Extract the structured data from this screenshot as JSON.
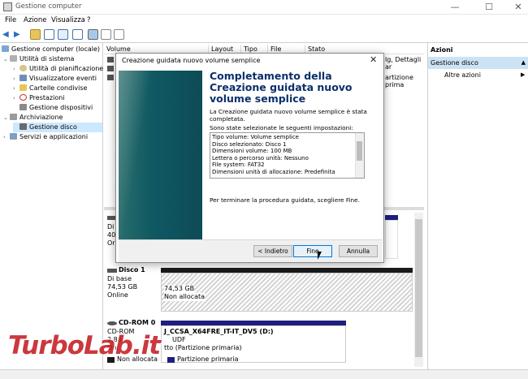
{
  "window": {
    "title": "Gestione computer",
    "minimize": "—",
    "maximize": "☐",
    "close": "✕"
  },
  "menu": [
    "File",
    "Azione",
    "Visualizza",
    "?"
  ],
  "tree": {
    "root": "Gestione computer (locale)",
    "items": [
      "Utilità di sistema",
      "Utilità di pianificazione",
      "Visualizzatore eventi",
      "Cartelle condivise",
      "Prestazioni",
      "Gestione dispositivi",
      "Archiviazione",
      "Gestione disco",
      "Servizi e applicazioni"
    ]
  },
  "volume_table": {
    "columns": [
      "Volume",
      "Layout",
      "Tipo",
      "File system",
      "Stato"
    ],
    "row_fragments": [
      "lg, Dettagli ar",
      "artizione prima"
    ]
  },
  "disks": {
    "disk0": {
      "lines": [
        "Di",
        "40",
        "Or"
      ]
    },
    "disk1": {
      "name": "Disco 1",
      "type": "Di base",
      "size": "74,53 GB",
      "status": "Online",
      "partition_size": "74,53 GB",
      "partition_state": "Non allocata"
    },
    "cdrom": {
      "name": "CD-ROM 0",
      "type": "CD-ROM",
      "size": "3,80",
      "status": "Onl",
      "volume_label": "J_CCSA_X64FRE_IT-IT_DV5  (D:)",
      "fs": "UDF",
      "state": "tto (Partizione primaria)"
    }
  },
  "legend": [
    "Non allocata",
    "Partizione primaria"
  ],
  "actions": {
    "header": "Azioni",
    "section": "Gestione disco",
    "more": "Altre azioni"
  },
  "dialog": {
    "title": "Creazione guidata nuovo volume semplice",
    "close": "✕",
    "heading": "Completamento della Creazione guidata nuovo volume semplice",
    "intro": "La Creazione guidata nuovo volume semplice è stata completata.",
    "selected_label": "Sono state selezionate le seguenti impostazioni:",
    "settings": [
      "Tipo volume: Volume semplice",
      "Disco selezionato: Disco 1",
      "Dimensioni volume: 100 MB",
      "Lettera o percorso unità: Nessuno",
      "File system: FAT32",
      "Dimensioni unità di allocazione: Predefinita"
    ],
    "finish_hint": "Per terminare la procedura guidata, scegliere Fine.",
    "buttons": {
      "back": "< Indietro",
      "finish": "Fine",
      "cancel": "Annulla"
    }
  },
  "watermark": "TurboLab.it",
  "colors": {
    "accent": "#0078d7",
    "partition_primary": "#1e1e80",
    "unallocated": "#1a1a1a",
    "wizard_side": "#0f5962",
    "watermark": "#c3161c"
  }
}
